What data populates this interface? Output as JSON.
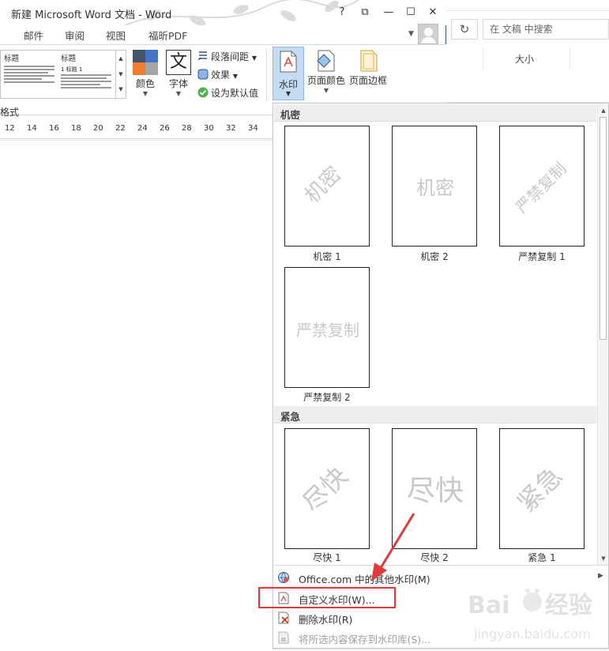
{
  "window": {
    "title": "新建 Microsoft Word 文档 - Word",
    "controls": {
      "help": "?",
      "restore": "⧉",
      "minimize": "—",
      "maximize": "☐",
      "close": "✕"
    }
  },
  "tabs": [
    {
      "label": "邮件"
    },
    {
      "label": "审阅"
    },
    {
      "label": "视图"
    },
    {
      "label": "福昕PDF"
    }
  ],
  "ribbon": {
    "style_gallery": {
      "cells": [
        {
          "heading": "标题",
          "subheading": ""
        },
        {
          "heading": "标题",
          "subheading": "1 标题 1"
        }
      ]
    },
    "colors_label": "颜色",
    "fonts_label": "字体",
    "font_glyph": "文",
    "paragraph_spacing_label": "段落间距",
    "effects_label": "效果",
    "set_default_label": "设为默认值",
    "watermark_label": "水印",
    "page_color_label": "页面颜色",
    "page_border_label": "页面边框",
    "group_label": "格式"
  },
  "ruler": {
    "ticks": [
      "12",
      "14",
      "16",
      "18",
      "20",
      "22",
      "24",
      "26",
      "28",
      "30",
      "32",
      "34"
    ]
  },
  "explorer": {
    "refresh_glyph": "↻",
    "search_placeholder": "在 文稿 中搜索",
    "column_header": "大小"
  },
  "watermark_gallery": {
    "sections": [
      {
        "header": "机密",
        "items": [
          {
            "label": "机密 1",
            "wm_text": "机密",
            "style": "diagonal"
          },
          {
            "label": "机密 2",
            "wm_text": "机密",
            "style": "horizontal"
          },
          {
            "label": "严禁复制 1",
            "wm_text": "严禁复制",
            "style": "diagonal"
          },
          {
            "label": "严禁复制 2",
            "wm_text": "严禁复制",
            "style": "horizontal"
          }
        ]
      },
      {
        "header": "紧急",
        "items": [
          {
            "label": "尽快 1",
            "wm_text": "尽快",
            "style": "diagonal"
          },
          {
            "label": "尽快 2",
            "wm_text": "尽快",
            "style": "horizontal"
          },
          {
            "label": "紧急 1",
            "wm_text": "紧急",
            "style": "diagonal"
          }
        ]
      }
    ],
    "menu": [
      {
        "label": "Office.com 中的其他水印(M)",
        "icon": "office-globe-icon",
        "submenu": true,
        "enabled": true
      },
      {
        "label": "自定义水印(W)...",
        "icon": "custom-watermark-icon",
        "submenu": false,
        "enabled": true
      },
      {
        "label": "删除水印(R)",
        "icon": "remove-watermark-icon",
        "submenu": false,
        "enabled": true
      },
      {
        "label": "将所选内容保存到水印库(S)...",
        "icon": "save-to-gallery-icon",
        "submenu": false,
        "enabled": false
      }
    ]
  },
  "colors": {
    "accent": "#2b579a",
    "highlight_box": "#e03a3a",
    "watermark_text": "#c9c9c9",
    "theme_swatches": [
      "#44546a",
      "#4472c4",
      "#ed7d31",
      "#a5a5a5"
    ]
  }
}
